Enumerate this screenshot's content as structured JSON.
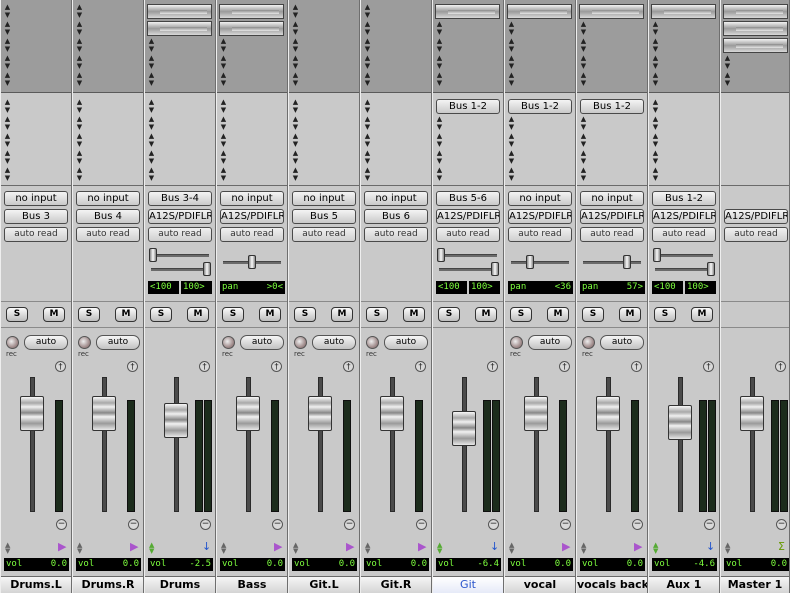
{
  "strips": [
    {
      "name": "Drums.L",
      "input": "no input",
      "output": "Bus 3",
      "auto_mode": "auto read",
      "sends": [],
      "inserts_count": 0,
      "pan_type": "none",
      "solo": "S",
      "mute": "M",
      "rec_label": "rec",
      "auto": "auto",
      "vol_label": "vol",
      "vol": "0.0",
      "playicon": "purple"
    },
    {
      "name": "Drums.R",
      "input": "no input",
      "output": "Bus 4",
      "auto_mode": "auto read",
      "sends": [],
      "inserts_count": 0,
      "pan_type": "none",
      "solo": "S",
      "mute": "M",
      "rec_label": "rec",
      "auto": "auto",
      "vol_label": "vol",
      "vol": "0.0",
      "playicon": "purple"
    },
    {
      "name": "Drums",
      "input": "Bus 3-4",
      "output": "A12S/PDIFLR",
      "auto_mode": "auto read",
      "sends": [],
      "inserts_count": 2,
      "pan_type": "stereo",
      "pan_left": "<100",
      "pan_right": "100>",
      "solo": "S",
      "mute": "M",
      "rec_label": "",
      "auto": "",
      "vol_label": "vol",
      "vol": "-2.5",
      "playicon": "blue"
    },
    {
      "name": "Bass",
      "input": "no input",
      "output": "A12S/PDIFLR",
      "auto_mode": "auto read",
      "sends": [],
      "inserts_count": 2,
      "pan_type": "mono",
      "pan_label": "pan",
      "pan_value": ">0<",
      "solo": "S",
      "mute": "M",
      "rec_label": "rec",
      "auto": "auto",
      "vol_label": "vol",
      "vol": "0.0",
      "playicon": "purple"
    },
    {
      "name": "Git.L",
      "input": "no input",
      "output": "Bus 5",
      "auto_mode": "auto read",
      "sends": [],
      "inserts_count": 0,
      "pan_type": "none",
      "solo": "S",
      "mute": "M",
      "rec_label": "rec",
      "auto": "auto",
      "vol_label": "vol",
      "vol": "0.0",
      "playicon": "purple"
    },
    {
      "name": "Git.R",
      "input": "no input",
      "output": "Bus 6",
      "auto_mode": "auto read",
      "sends": [],
      "inserts_count": 0,
      "pan_type": "none",
      "solo": "S",
      "mute": "M",
      "rec_label": "rec",
      "auto": "auto",
      "vol_label": "vol",
      "vol": "0.0",
      "playicon": "purple"
    },
    {
      "name": "Git",
      "input": "Bus 5-6",
      "output": "A12S/PDIFLR",
      "auto_mode": "auto read",
      "sends": [
        "Bus 1-2"
      ],
      "inserts_count": 1,
      "pan_type": "stereo",
      "pan_left": "<100",
      "pan_right": "100>",
      "solo": "S",
      "mute": "M",
      "rec_label": "",
      "auto": "",
      "vol_label": "vol",
      "vol": "-6.4",
      "playicon": "blue",
      "selected": true
    },
    {
      "name": "vocal",
      "input": "no input",
      "output": "A12S/PDIFLR",
      "auto_mode": "auto read",
      "sends": [
        "Bus 1-2"
      ],
      "inserts_count": 1,
      "pan_type": "mono",
      "pan_label": "pan",
      "pan_value": "<36",
      "solo": "S",
      "mute": "M",
      "rec_label": "rec",
      "auto": "auto",
      "vol_label": "vol",
      "vol": "0.0",
      "playicon": "purple"
    },
    {
      "name": "vocals back",
      "input": "no input",
      "output": "A12S/PDIFLR",
      "auto_mode": "auto read",
      "sends": [
        "Bus 1-2"
      ],
      "inserts_count": 1,
      "pan_type": "mono",
      "pan_label": "pan",
      "pan_value": "57>",
      "solo": "S",
      "mute": "M",
      "rec_label": "rec",
      "auto": "auto",
      "vol_label": "vol",
      "vol": "0.0",
      "playicon": "purple"
    },
    {
      "name": "Aux 1",
      "input": "Bus 1-2",
      "output": "A12S/PDIFLR",
      "auto_mode": "auto read",
      "sends": [],
      "inserts_count": 1,
      "pan_type": "stereo",
      "pan_left": "<100",
      "pan_right": "100>",
      "solo": "S",
      "mute": "M",
      "rec_label": "",
      "auto": "",
      "vol_label": "vol",
      "vol": "-4.6",
      "playicon": "blue"
    },
    {
      "name": "Master 1",
      "input": "",
      "output": "A12S/PDIFLR",
      "auto_mode": "auto read",
      "sends": [],
      "inserts_count": 3,
      "pan_type": "none",
      "solo": "",
      "mute": "",
      "rec_label": "",
      "auto": "",
      "vol_label": "vol",
      "vol": "0.0",
      "playicon": "sigma"
    }
  ],
  "pan_position": {
    "Drums": [
      0,
      1
    ],
    "Bass": 0.5,
    "Git": [
      0,
      1
    ],
    "vocal": 0.32,
    "vocals back": 0.78,
    "Aux 1": [
      0,
      1
    ]
  },
  "fader_level": {
    "Drums.L": 0.81,
    "Drums.R": 0.81,
    "Drums": 0.74,
    "Bass": 0.81,
    "Git.L": 0.81,
    "Git.R": 0.81,
    "Git": 0.66,
    "vocal": 0.81,
    "vocals back": 0.81,
    "Aux 1": 0.72,
    "Master 1": 0.81
  },
  "colors": {
    "display_text": "#7dff3e",
    "selected_name": "#2a55cc",
    "automation_play": "#aa55cc",
    "automation_play_alt": "#2255cc"
  }
}
